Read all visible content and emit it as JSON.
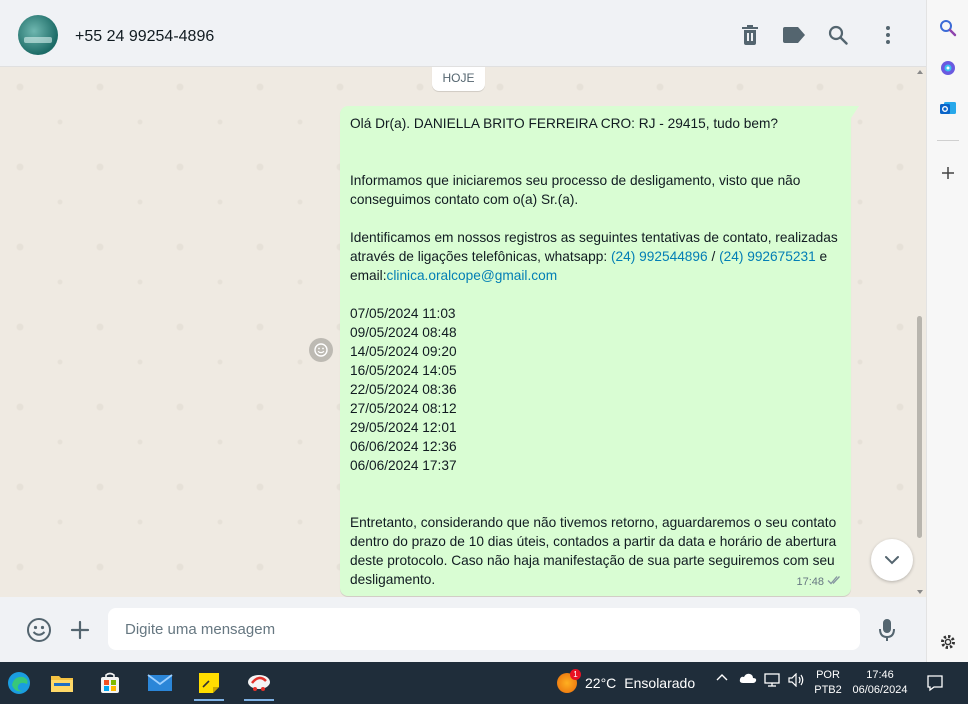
{
  "header": {
    "contact_name": "+55 24 99254-4896",
    "icons": [
      "delete-icon",
      "label-icon",
      "search-icon",
      "more-vertical-icon"
    ]
  },
  "chat": {
    "date_chip": "HOJE",
    "message": {
      "greeting": "Olá Dr(a). DANIELLA BRITO FERREIRA CRO: RJ - 29415, tudo bem?",
      "paragraph1": "Informamos que iniciaremos seu processo de desligamento, visto que não conseguimos contato com o(a) Sr.(a).",
      "paragraph2_prefix": "Identificamos em nossos registros as seguintes tentativas de contato, realizadas através de ligações telefônicas, whatsapp: ",
      "phone1": "(24) 992544896",
      "separator": " / ",
      "phone2": "(24) 992675231",
      "email_prefix": " e email:",
      "email": "clinica.oralcope@gmail.com",
      "attempts": [
        "07/05/2024 11:03",
        "09/05/2024 08:48",
        "14/05/2024 09:20",
        "16/05/2024 14:05",
        "22/05/2024 08:36",
        "27/05/2024 08:12",
        "29/05/2024 12:01",
        "06/06/2024 12:36",
        "06/06/2024 17:37"
      ],
      "paragraph3": "Entretanto, considerando que não tivemos retorno, aguardaremos o seu contato dentro do prazo de 10 dias úteis, contados a partir da data e horário de abertura deste protocolo. Caso não haja manifestação de sua parte seguiremos com seu desligamento.",
      "time": "17:48",
      "status": "read"
    }
  },
  "composer": {
    "placeholder": "Digite uma mensagem"
  },
  "taskbar": {
    "temperature": "22°C",
    "weather_text": "Ensolarado",
    "weather_badge": "1",
    "lang_line1": "POR",
    "lang_line2": "PTB2",
    "time": "17:46",
    "date": "06/06/2024"
  },
  "colors": {
    "bubble": "#d9fdd3",
    "link": "#027eb5",
    "chat_bg": "#efeae2",
    "header_bg": "#f0f2f5",
    "taskbar_bg": "#1f2d3a"
  }
}
